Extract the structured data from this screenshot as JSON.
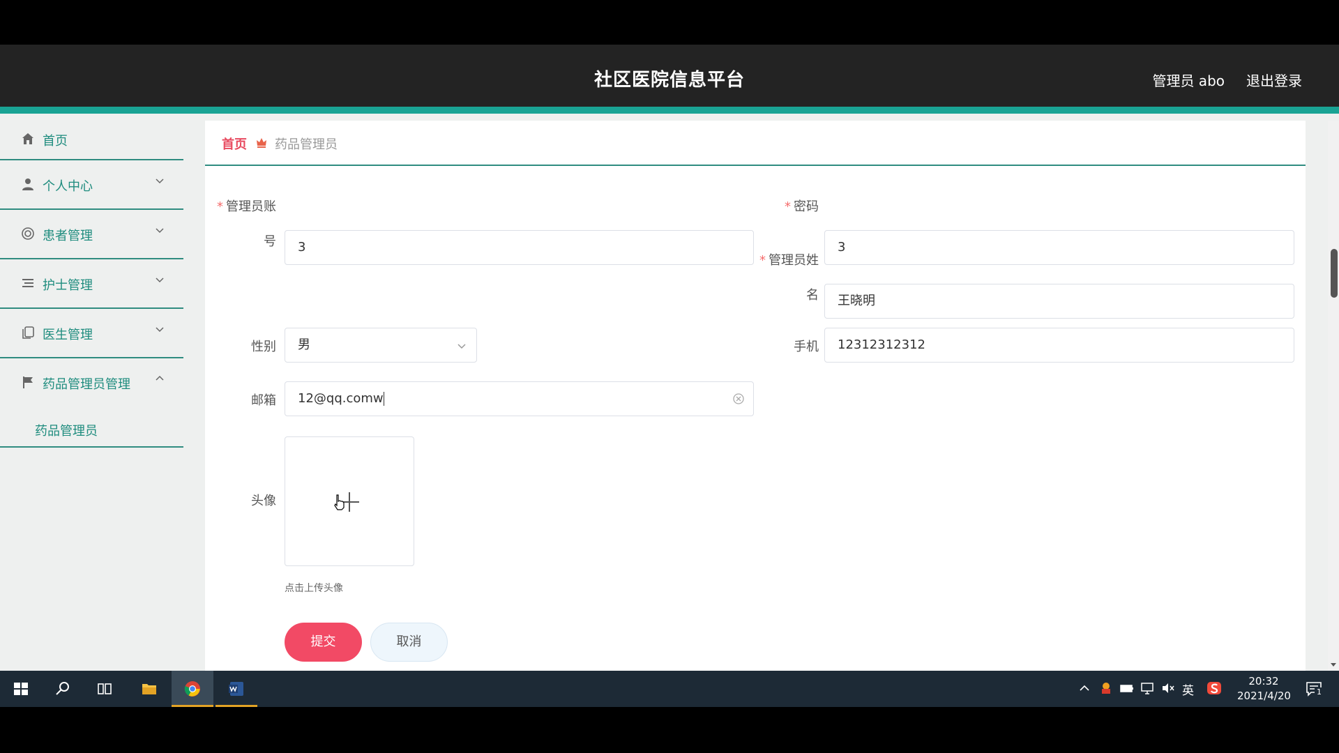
{
  "header": {
    "title": "社区医院信息平台",
    "user": "管理员 abo",
    "logout": "退出登录"
  },
  "sidebar": {
    "items": [
      {
        "label": "首页"
      },
      {
        "label": "个人中心"
      },
      {
        "label": "患者管理"
      },
      {
        "label": "护士管理"
      },
      {
        "label": "医生管理"
      },
      {
        "label": "药品管理员管理"
      }
    ],
    "sub_items": [
      {
        "label": "药品管理员"
      }
    ]
  },
  "breadcrumb": {
    "home": "首页",
    "current": "药品管理员"
  },
  "form": {
    "account_label_line1": "管理员账",
    "account_label_line2": "号",
    "account_value": "3",
    "password_label": "密码",
    "password_value": "3",
    "name_label_line1": "管理员姓",
    "name_label_line2": "名",
    "name_value": "王晓明",
    "gender_label": "性别",
    "gender_value": "男",
    "phone_label": "手机",
    "phone_value": "12312312312",
    "email_label": "邮箱",
    "email_value": "12@qq.comw",
    "avatar_label": "头像",
    "upload_tip": "点击上传头像",
    "required_mark": "*",
    "submit_label": "提交",
    "cancel_label": "取消"
  },
  "ime": {
    "lang": "英"
  },
  "taskbar": {
    "lang": "英",
    "time": "20:32",
    "date": "2021/4/20",
    "notifications": "1"
  },
  "colors": {
    "header_bg": "#232323",
    "accent": "#19a394",
    "submit": "#f24a65",
    "breadcrumb_home": "#e84a5f"
  }
}
